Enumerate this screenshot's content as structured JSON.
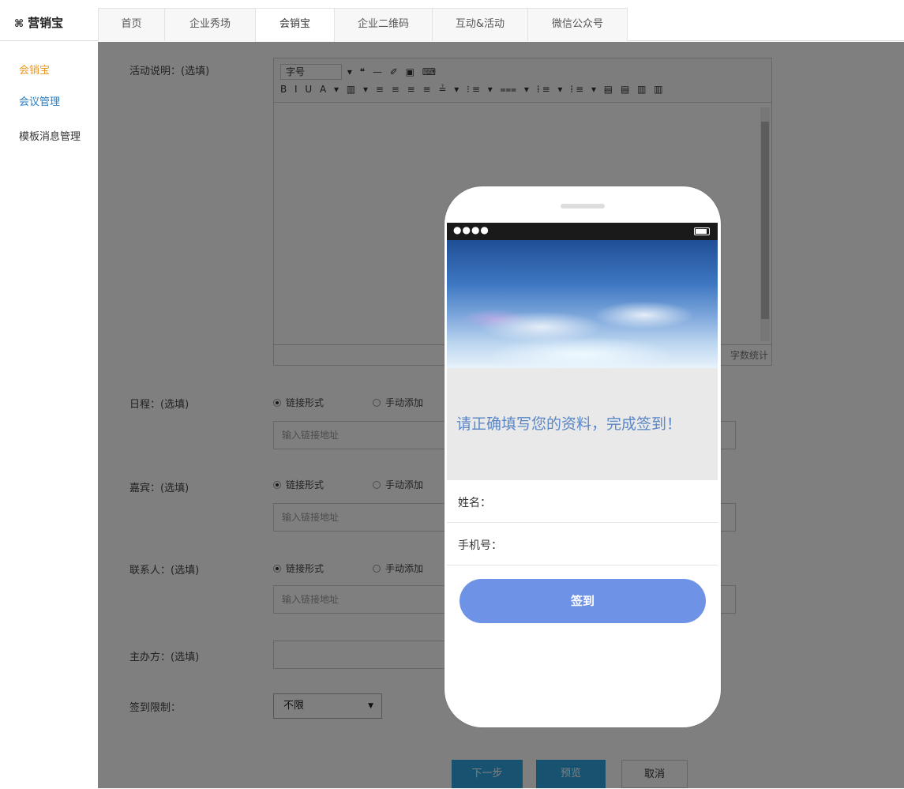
{
  "brand": {
    "logo": "⌘",
    "name": "营销宝"
  },
  "tabs": [
    "首页",
    "企业秀场",
    "会销宝",
    "企业二维码",
    "互动&活动",
    "微信公众号"
  ],
  "active_tab": 2,
  "sidebar": {
    "items": [
      {
        "label": "会销宝",
        "color": "#e8961e"
      },
      {
        "label": "会议管理",
        "color": "#2a7fc4"
      },
      {
        "label": "模板消息管理",
        "color": "#333333"
      }
    ]
  },
  "form": {
    "description_label": "活动说明：(选填)",
    "editor": {
      "font_size": "字号",
      "toolbar_row1": "▾ ❝ — ✐ ▣ ⌨",
      "toolbar_row2": "B I U A ▾ ▥ ▾ ≡ ≡ ≡ ≡ ≟ ▾ ⁝≡ ▾ ⩶ ▾ ⁞≡ ▾ ⁞≡ ▾ ▤ ▤ ▥ ▥",
      "word_count": "字数统计"
    },
    "schedule": {
      "label": "日程：(选填)",
      "option_link": "链接形式",
      "option_manual": "手动添加",
      "placeholder": "输入链接地址"
    },
    "guests": {
      "label": "嘉宾：(选填)",
      "option_link": "链接形式",
      "option_manual": "手动添加",
      "placeholder": "输入链接地址"
    },
    "contact": {
      "label": "联系人：(选填)",
      "option_link": "链接形式",
      "option_manual": "手动添加",
      "placeholder": "输入链接地址"
    },
    "organizer_label": "主办方：(选填)",
    "checkin_limit_label": "签到限制：",
    "checkin_limit_value": "不限",
    "buttons": {
      "next": "下一步",
      "preview": "预览",
      "cancel": "取消"
    }
  },
  "phone": {
    "signal": "●●●●",
    "headline": "请正确填写您的资料，完成签到！",
    "name_label": "姓名：",
    "phone_label": "手机号：",
    "submit": "签到"
  }
}
